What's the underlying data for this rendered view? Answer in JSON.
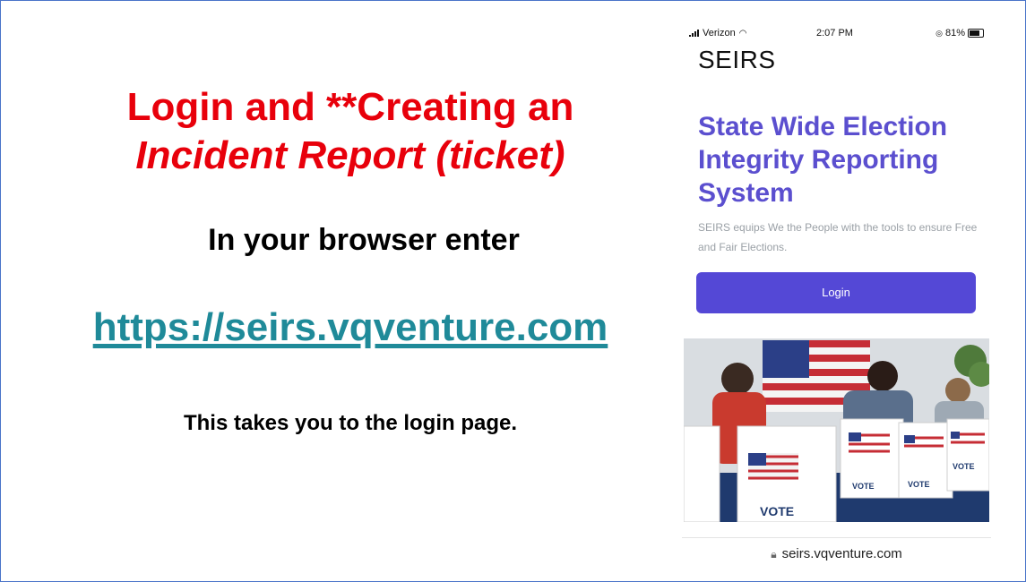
{
  "slide": {
    "title_line1": "Login and **Creating an",
    "title_line2": "Incident Report (ticket)",
    "instruction": "In your browser enter",
    "url": "https://seirs.vqventure.com",
    "note": "This takes you to the login page."
  },
  "phone": {
    "status": {
      "carrier": "Verizon",
      "time": "2:07 PM",
      "battery": "81%"
    },
    "brand": "SEIRS",
    "hero_title": "State Wide Election Integrity Reporting System",
    "hero_subtitle": "SEIRS equips We the People with the tools to ensure Free and Fair Elections.",
    "login_label": "Login",
    "booth_sign": "VOTE",
    "address": "seirs.vqventure.com"
  },
  "colors": {
    "title_red": "#e8000b",
    "link_teal": "#1f8a99",
    "brand_purple": "#5b4fcf",
    "button_purple": "#5448d6"
  }
}
